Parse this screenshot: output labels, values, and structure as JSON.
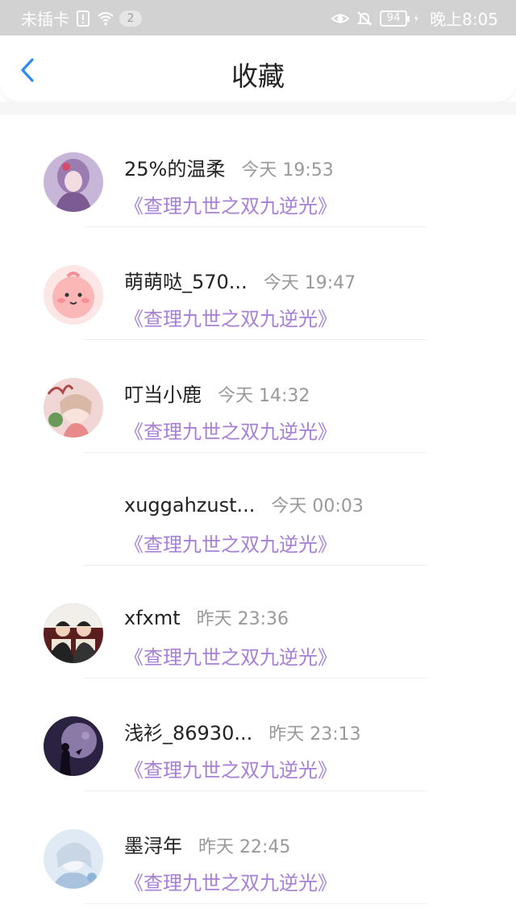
{
  "status_bar": {
    "carrier": "未插卡",
    "notification_count": "2",
    "battery": "94",
    "time": "晚上8:05",
    "icons": [
      "sim-alert-icon",
      "wifi-icon",
      "eye-icon",
      "mute-bell-icon",
      "charging-icon"
    ]
  },
  "nav": {
    "back_icon": "chevron-left-icon",
    "title": "收藏",
    "accent_color": "#2a8cf0"
  },
  "colors": {
    "book_title": "#a67fd6",
    "time": "#999999"
  },
  "items": [
    {
      "name": "25%的温柔",
      "time": "今天 19:53",
      "book": "《查理九世之双九逆光》"
    },
    {
      "name": "萌萌哒_570...",
      "time": "今天 19:47",
      "book": "《查理九世之双九逆光》"
    },
    {
      "name": "叮当小鹿",
      "time": "今天 14:32",
      "book": "《查理九世之双九逆光》"
    },
    {
      "name": "xuggahzust...",
      "time": "今天 00:03",
      "book": "《查理九世之双九逆光》"
    },
    {
      "name": "xfxmt",
      "time": "昨天 23:36",
      "book": "《查理九世之双九逆光》"
    },
    {
      "name": "浅衫_86930...",
      "time": "昨天 23:13",
      "book": "《查理九世之双九逆光》"
    },
    {
      "name": "墨浔年",
      "time": "昨天 22:45",
      "book": "《查理九世之双九逆光》"
    }
  ]
}
